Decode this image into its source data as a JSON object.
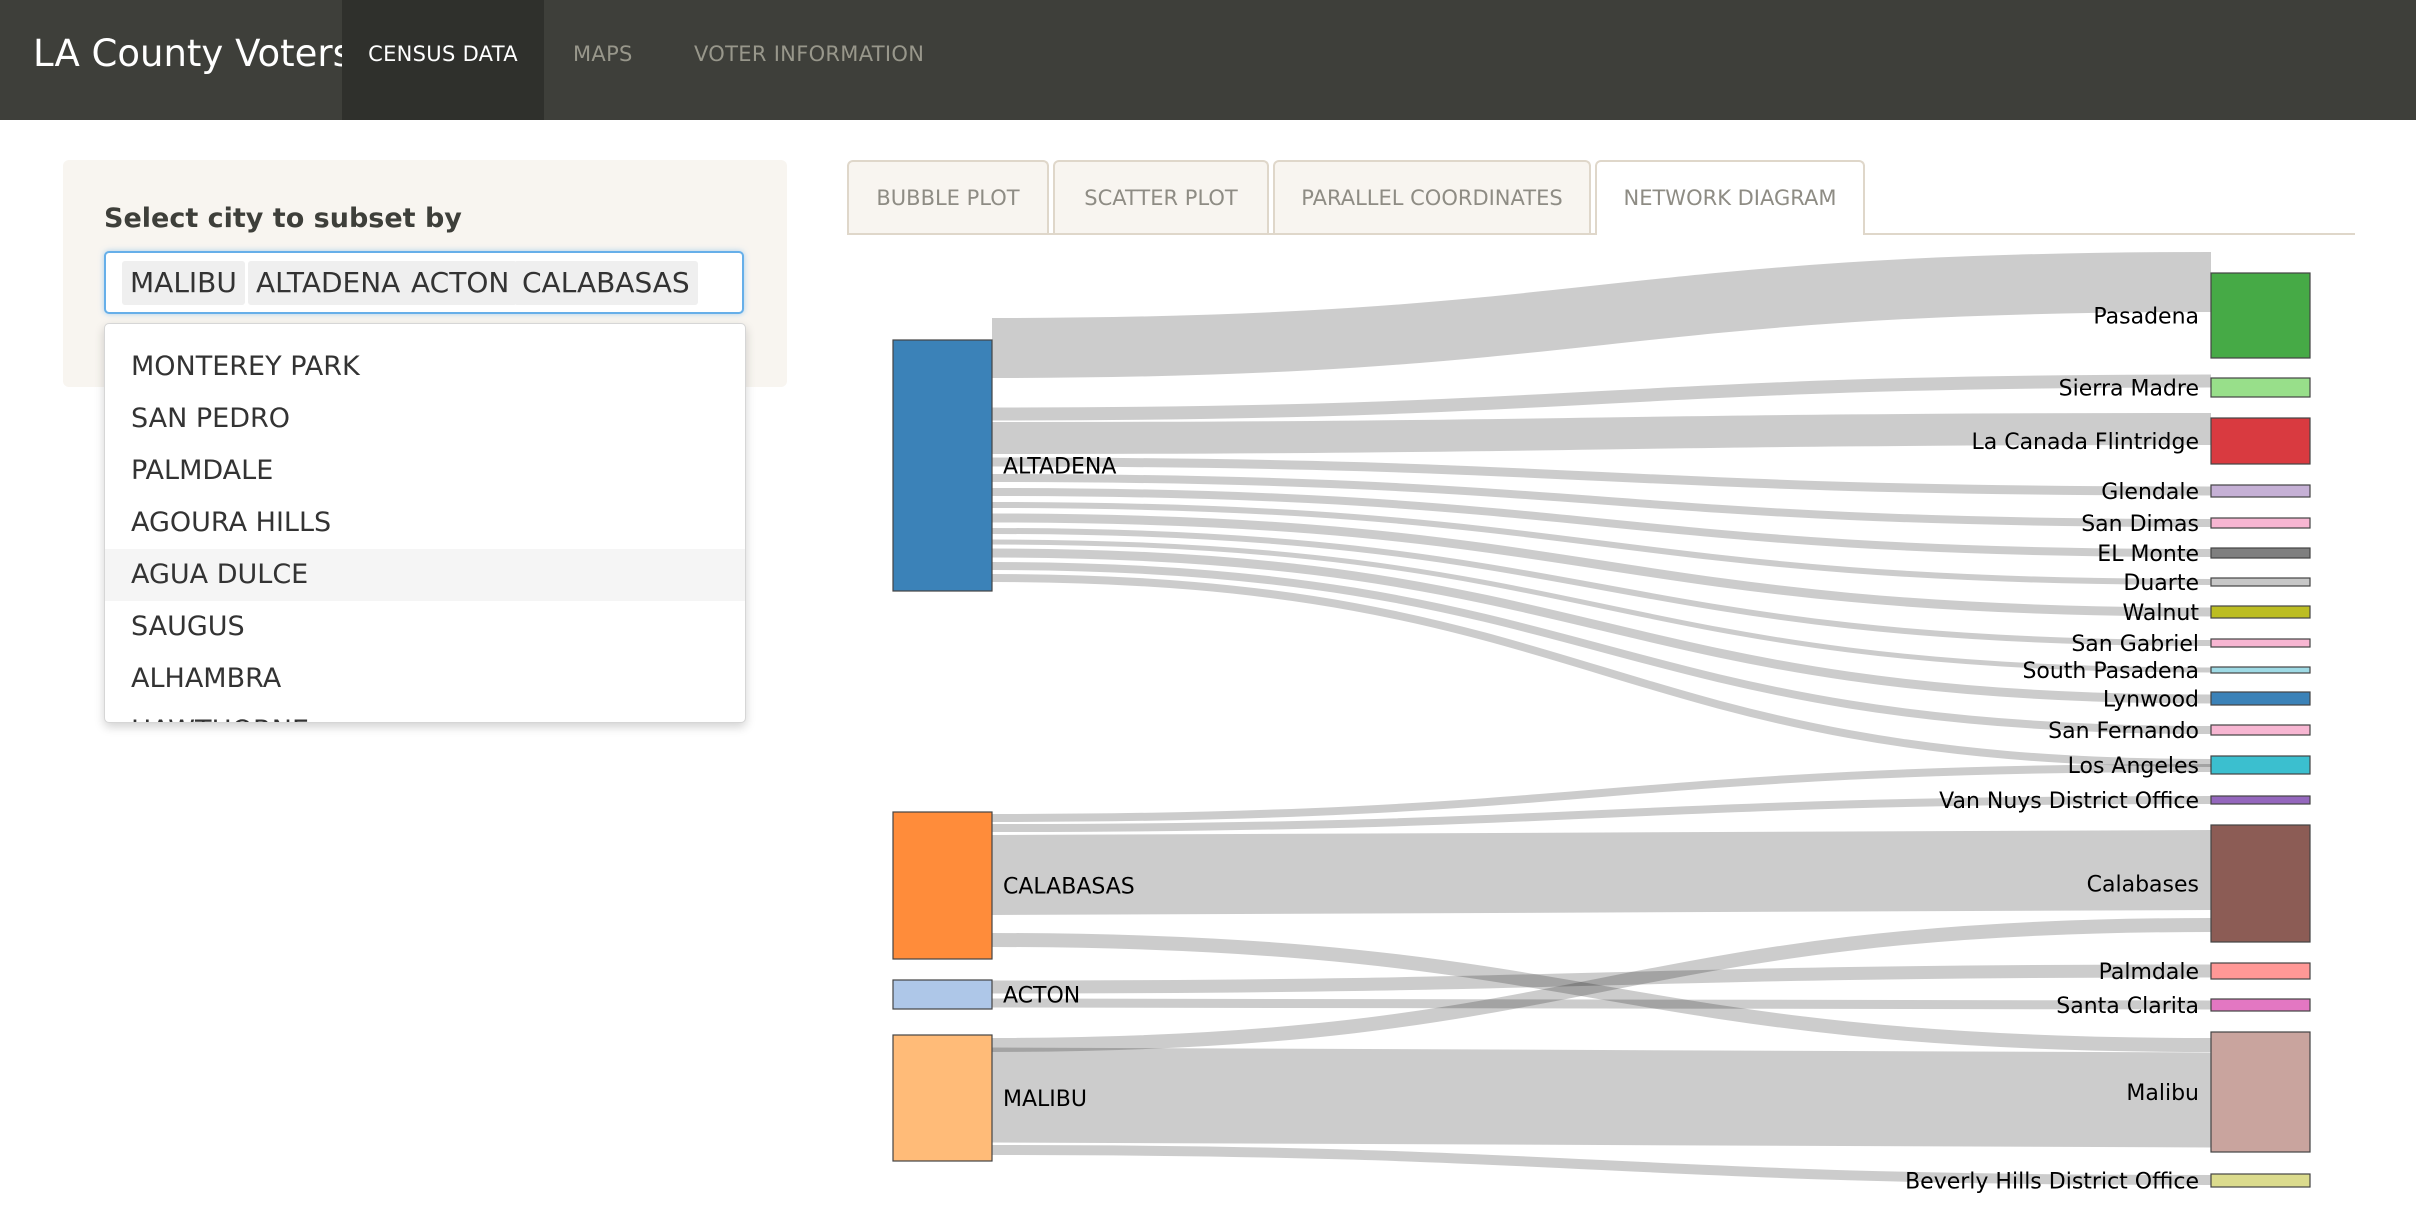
{
  "app": {
    "title": "LA County Voters"
  },
  "nav": [
    {
      "label": "CENSUS DATA",
      "active": true
    },
    {
      "label": "MAPS",
      "active": false
    },
    {
      "label": "VOTER INFORMATION",
      "active": false
    }
  ],
  "filter": {
    "label": "Select city to subset by",
    "selected": [
      "MALIBU",
      "ALTADENA",
      "ACTON",
      "CALABASAS"
    ],
    "options": [
      "MONTEREY PARK",
      "SAN PEDRO",
      "PALMDALE",
      "AGOURA HILLS",
      "AGUA DULCE",
      "SAUGUS",
      "ALHAMBRA",
      "HAWTHORNE"
    ],
    "highlighted_option": "AGUA DULCE"
  },
  "tabs": [
    {
      "label": "BUBBLE PLOT",
      "active": false
    },
    {
      "label": "SCATTER PLOT",
      "active": false
    },
    {
      "label": "PARALLEL COORDINATES",
      "active": false
    },
    {
      "label": "NETWORK DIAGRAM",
      "active": true
    }
  ],
  "network": {
    "sources": [
      {
        "name": "ALTADENA",
        "color": "#3b82b8"
      },
      {
        "name": "CALABASAS",
        "color": "#ff8c3a"
      },
      {
        "name": "ACTON",
        "color": "#aec7e8"
      },
      {
        "name": "MALIBU",
        "color": "#ffbb78"
      }
    ],
    "targets": [
      {
        "name": "Pasadena",
        "color": "#46aa46"
      },
      {
        "name": "Sierra Madre",
        "color": "#98df8a"
      },
      {
        "name": "La Canada Flintridge",
        "color": "#d93a40"
      },
      {
        "name": "Glendale",
        "color": "#c5b0d5"
      },
      {
        "name": "San Dimas",
        "color": "#f7b6d2"
      },
      {
        "name": "EL Monte",
        "color": "#7f7f7f"
      },
      {
        "name": "Duarte",
        "color": "#c7c7c7"
      },
      {
        "name": "Walnut",
        "color": "#bcbd22"
      },
      {
        "name": "San Gabriel",
        "color": "#f7b6d2"
      },
      {
        "name": "South Pasadena",
        "color": "#9edae5"
      },
      {
        "name": "Lynwood",
        "color": "#3b82b8"
      },
      {
        "name": "San Fernando",
        "color": "#f7b6d2"
      },
      {
        "name": "Los Angeles",
        "color": "#3bbfcf"
      },
      {
        "name": "Van Nuys District Office",
        "color": "#9467bd"
      },
      {
        "name": "Calabases",
        "color": "#8c5c55"
      },
      {
        "name": "Palmdale",
        "color": "#ff9896"
      },
      {
        "name": "Santa Clarita",
        "color": "#e377c2"
      },
      {
        "name": "Malibu",
        "color": "#c9a49e"
      },
      {
        "name": "Beverly Hills District Office",
        "color": "#dbdb8d"
      }
    ],
    "links": [
      {
        "source": "ALTADENA",
        "target": "Pasadena"
      },
      {
        "source": "ALTADENA",
        "target": "Sierra Madre"
      },
      {
        "source": "ALTADENA",
        "target": "La Canada Flintridge"
      },
      {
        "source": "ALTADENA",
        "target": "Glendale"
      },
      {
        "source": "ALTADENA",
        "target": "San Dimas"
      },
      {
        "source": "ALTADENA",
        "target": "EL Monte"
      },
      {
        "source": "ALTADENA",
        "target": "Duarte"
      },
      {
        "source": "ALTADENA",
        "target": "Walnut"
      },
      {
        "source": "ALTADENA",
        "target": "San Gabriel"
      },
      {
        "source": "ALTADENA",
        "target": "South Pasadena"
      },
      {
        "source": "ALTADENA",
        "target": "Lynwood"
      },
      {
        "source": "ALTADENA",
        "target": "San Fernando"
      },
      {
        "source": "ALTADENA",
        "target": "Los Angeles"
      },
      {
        "source": "CALABASAS",
        "target": "Los Angeles"
      },
      {
        "source": "CALABASAS",
        "target": "Van Nuys District Office"
      },
      {
        "source": "CALABASAS",
        "target": "Calabases"
      },
      {
        "source": "CALABASAS",
        "target": "Malibu"
      },
      {
        "source": "ACTON",
        "target": "Palmdale"
      },
      {
        "source": "ACTON",
        "target": "Santa Clarita"
      },
      {
        "source": "MALIBU",
        "target": "Calabases"
      },
      {
        "source": "MALIBU",
        "target": "Malibu"
      },
      {
        "source": "MALIBU",
        "target": "Beverly Hills District Office"
      }
    ]
  }
}
